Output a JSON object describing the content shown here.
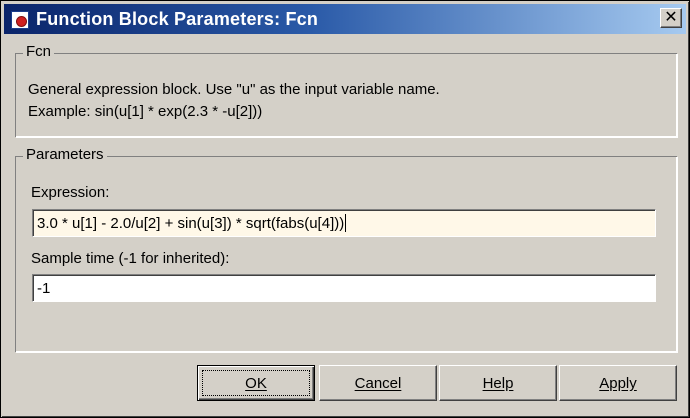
{
  "window": {
    "title": "Function Block Parameters: Fcn",
    "close_glyph": "✕"
  },
  "block_group": {
    "legend": "Fcn",
    "description_line1": "General expression block. Use \"u\" as the input variable name.",
    "description_line2": "Example: sin(u[1] * exp(2.3 * -u[2]))"
  },
  "params_group": {
    "legend": "Parameters",
    "expression": {
      "label": "Expression:",
      "value": "3.0 * u[1] - 2.0/u[2] + sin(u[3]) * sqrt(fabs(u[4]))"
    },
    "sample_time": {
      "label": "Sample time (-1 for inherited):",
      "value": "-1"
    }
  },
  "buttons": {
    "ok": "OK",
    "cancel": "Cancel",
    "help": "Help",
    "apply": "Apply"
  },
  "colors": {
    "titlebar_start": "#0a246a",
    "titlebar_end": "#a6caf0",
    "dialog_face": "#d4d0c8",
    "focused_input_bg": "#fff8e8"
  },
  "icons": {
    "app": "simulink-block-icon",
    "close": "close-icon"
  }
}
